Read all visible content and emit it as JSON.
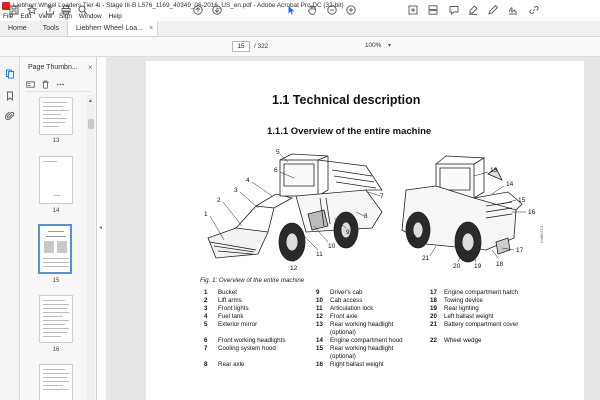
{
  "window": {
    "title": "Liebherr Wheel Loaders Tier 4i - Stage III-B L576_1169_40349_06-2016_US_en.pdf - Adobe Acrobat Pro DC (32-bit)"
  },
  "menu": [
    "File",
    "Edit",
    "View",
    "Sign",
    "Window",
    "Help"
  ],
  "tabs": {
    "home": "Home",
    "tools": "Tools",
    "doc": "Liebherr Wheel Loa...",
    "close": "×"
  },
  "toolbar": {
    "page_current": "15",
    "page_total": "/ 322",
    "zoom": "100%",
    "zoom_caret": "▾"
  },
  "panel": {
    "title": "Page Thumbn...",
    "close": "×",
    "thumbnails": [
      {
        "label": "13"
      },
      {
        "label": "14"
      },
      {
        "label": "15"
      },
      {
        "label": "16"
      }
    ],
    "collapse": "◂"
  },
  "document": {
    "heading1": "1.1  Technical description",
    "heading2": "1.1.1    Overview of the entire machine",
    "caption": "Fig. 1: Overview of the entire machine",
    "figure_code": "LMB0712",
    "callouts_left": [
      "1",
      "2",
      "3",
      "4",
      "5",
      "6",
      "7",
      "8",
      "9",
      "10",
      "11",
      "12"
    ],
    "callouts_right": [
      "13",
      "14",
      "15",
      "16",
      "17",
      "18",
      "19",
      "20",
      "21",
      "22"
    ],
    "legend": {
      "col1": [
        {
          "num": "1",
          "text": "Bucket"
        },
        {
          "num": "2",
          "text": "Lift arms"
        },
        {
          "num": "3",
          "text": "Front lights"
        },
        {
          "num": "4",
          "text": "Fuel tank"
        },
        {
          "num": "5",
          "text": "Exterior mirror"
        },
        {
          "num": "6",
          "text": "Front working headlights"
        },
        {
          "num": "7",
          "text": "Cooling system hood"
        },
        {
          "num": "8",
          "text": "Rear axle"
        }
      ],
      "col2": [
        {
          "num": "9",
          "text": "Driver's cab"
        },
        {
          "num": "10",
          "text": "Cab access"
        },
        {
          "num": "11",
          "text": "Articulation lock"
        },
        {
          "num": "12",
          "text": "Front axle"
        },
        {
          "num": "13",
          "text": "Rear working headlight"
        },
        {
          "num": "",
          "text": "(optional)"
        },
        {
          "num": "14",
          "text": "Engine compartment hood"
        },
        {
          "num": "15",
          "text": "Rear working headlight"
        },
        {
          "num": "",
          "text": "(optional)"
        },
        {
          "num": "16",
          "text": "Right ballast weight"
        }
      ],
      "col3": [
        {
          "num": "17",
          "text": "Engine compartment hatch"
        },
        {
          "num": "18",
          "text": "Towing device"
        },
        {
          "num": "19",
          "text": "Rear lighting"
        },
        {
          "num": "20",
          "text": "Left ballast weight"
        },
        {
          "num": "21",
          "text": "Battery compartment cover"
        },
        {
          "num": "22",
          "text": "Wheel wedge"
        }
      ]
    }
  }
}
